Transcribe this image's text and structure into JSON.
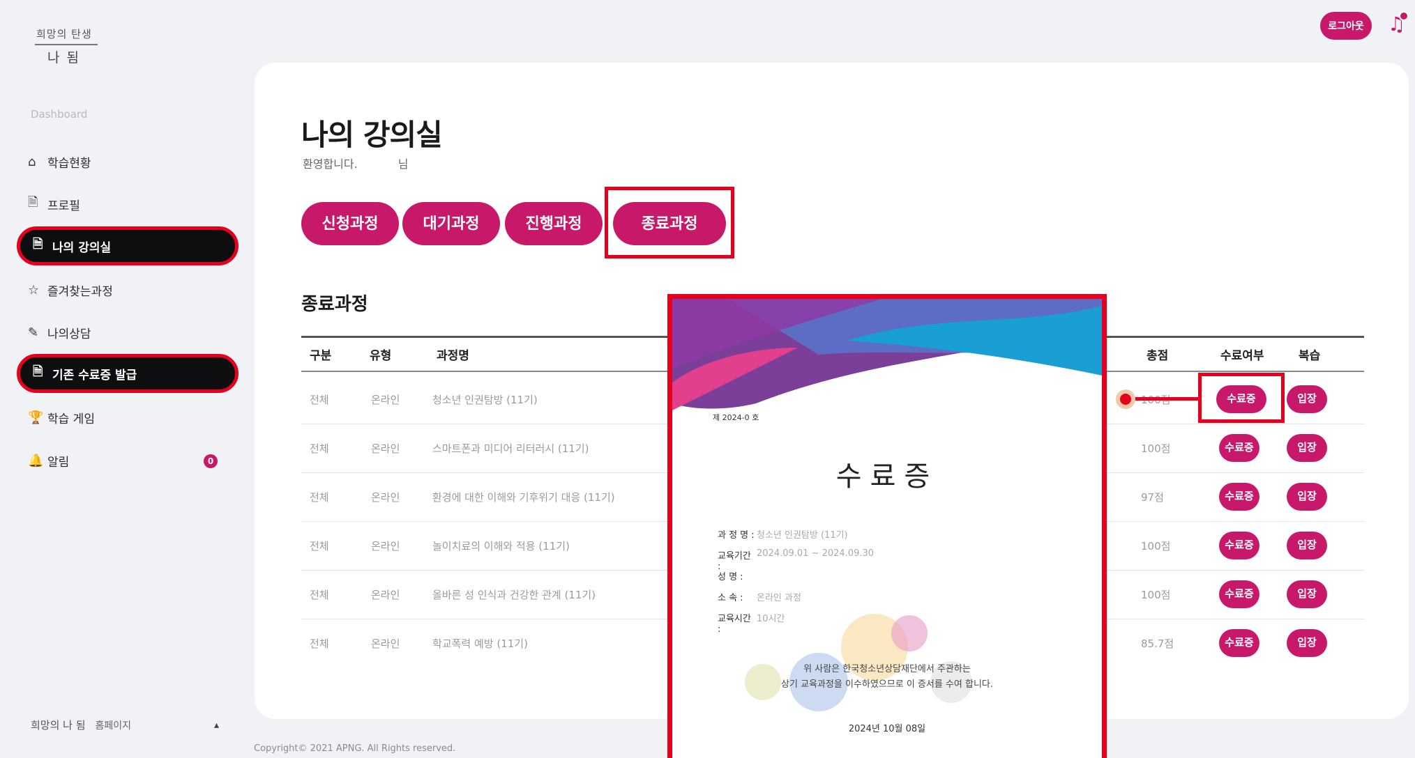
{
  "brand": {
    "logo_top": "희망의 탄생",
    "logo_bottom": "나 됨"
  },
  "sidebar": {
    "section_label": "Dashboard",
    "items": [
      {
        "label": "학습현황",
        "icon": "home-icon"
      },
      {
        "label": "프로필",
        "icon": "document-icon"
      },
      {
        "label": "나의 강의실",
        "icon": "document-icon"
      },
      {
        "label": "즐겨찾는과정",
        "icon": "star-icon"
      },
      {
        "label": "나의상담",
        "icon": "pencil-icon"
      },
      {
        "label": "기존 수료증 발급",
        "icon": "document-icon"
      },
      {
        "label": "학습 게임",
        "icon": "trophy-icon"
      },
      {
        "label": "알림",
        "icon": "bell-icon",
        "badge": "0"
      }
    ],
    "footer": {
      "logo": "희망의 나 됨",
      "label": "홈페이지"
    }
  },
  "header": {
    "logout_label": "로그아웃",
    "accent": "#c8186a",
    "highlight": "#e6001e"
  },
  "main": {
    "title": "나의 강의실",
    "welcome": "환영합니다.",
    "user_suffix": "님",
    "tabs": [
      "신청과정",
      "대기과정",
      "진행과정",
      "종료과정"
    ],
    "section_title": "종료과정",
    "table": {
      "headers": [
        "구분",
        "유형",
        "과정명",
        "총점",
        "수료여부",
        "복습"
      ],
      "rows": [
        {
          "category": "전체",
          "type": "온라인",
          "course": "청소년 인권탐방 (11기)",
          "score": "100점",
          "cert": "수료증",
          "review": "입장"
        },
        {
          "category": "전체",
          "type": "온라인",
          "course": "스마트폰과 미디어 리터러시 (11기)",
          "score": "100점",
          "cert": "수료증",
          "review": "입장"
        },
        {
          "category": "전체",
          "type": "온라인",
          "course": "환경에 대한 이해와 기후위기 대응 (11기)",
          "score": "97점",
          "cert": "수료증",
          "review": "입장"
        },
        {
          "category": "전체",
          "type": "온라인",
          "course": "놀이치료의 이해와 적용 (11기)",
          "score": "100점",
          "cert": "수료증",
          "review": "입장"
        },
        {
          "category": "전체",
          "type": "온라인",
          "course": "올바른 성 인식과 건강한 관계 (11기)",
          "score": "100점",
          "cert": "수료증",
          "review": "입장"
        },
        {
          "category": "전체",
          "type": "온라인",
          "course": "학교폭력 예방 (11기)",
          "score": "85.7점",
          "cert": "수료증",
          "review": "입장"
        }
      ]
    }
  },
  "certificate": {
    "number": "제 2024-0 호",
    "title": "수료증",
    "fields": [
      {
        "label": "과 정 명 :",
        "value": "청소년 인권탐방 (11기)"
      },
      {
        "label": "교육기간 :",
        "value": "2024.09.01 ~ 2024.09.30"
      },
      {
        "label": "성 명 :",
        "value": ""
      },
      {
        "label": "소 속 :",
        "value": "온라인 과정"
      },
      {
        "label": "교육시간 :",
        "value": "10시간"
      }
    ],
    "message_line1": "위 사람은 한국청소년상담재단에서 주관하는",
    "message_line2": "상기 교육과정을 이수하였으므로 이 증서를 수여 합니다.",
    "date": "2024년 10월 08일"
  },
  "footer": {
    "copyright": "Copyright© 2021 APNG. All Rights reserved."
  }
}
